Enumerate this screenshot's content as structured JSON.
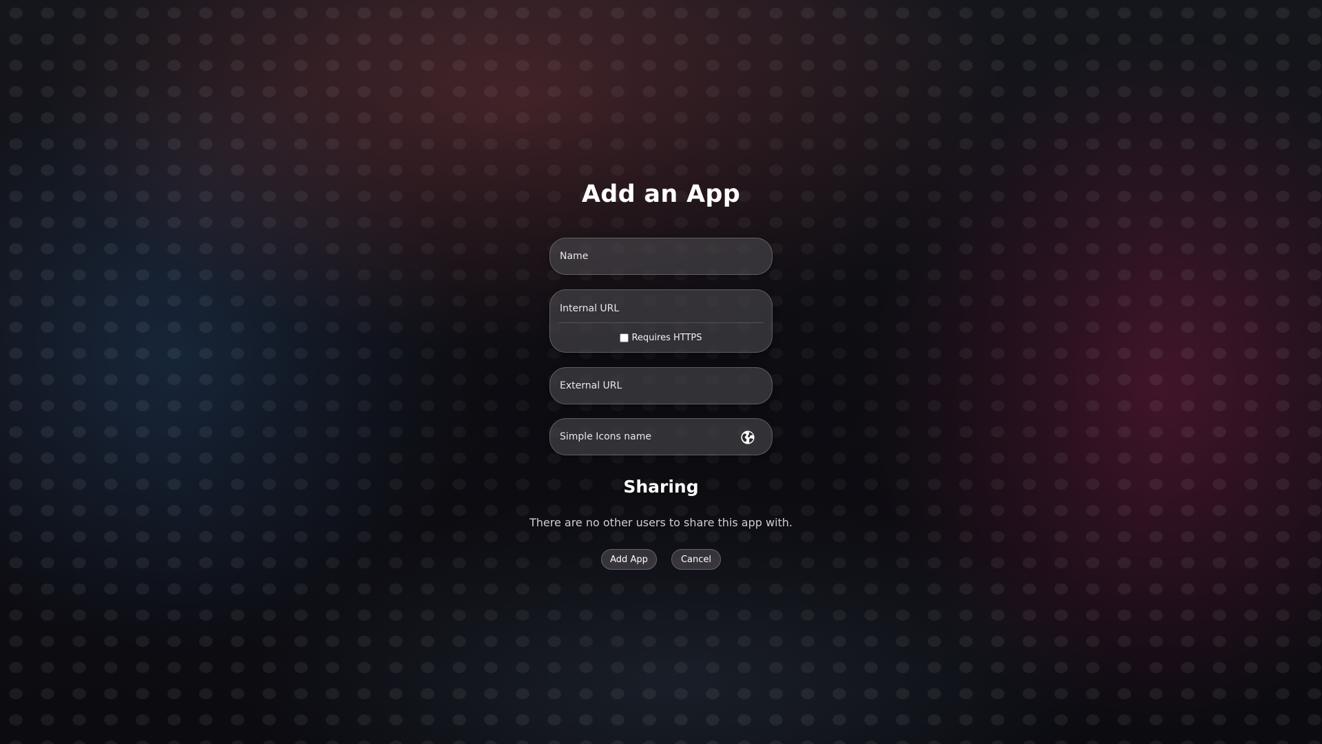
{
  "page": {
    "title": "Add an App"
  },
  "form": {
    "name_placeholder": "Name",
    "internal_url_placeholder": "Internal URL",
    "requires_https_label": "Requires HTTPS",
    "requires_https_checked": false,
    "external_url_placeholder": "External URL",
    "simple_icons_placeholder": "Simple Icons name",
    "icon_preview": "globe-icon"
  },
  "sharing": {
    "title": "Sharing",
    "empty_text": "There are no other users to share this app with."
  },
  "actions": {
    "add_label": "Add App",
    "cancel_label": "Cancel"
  }
}
